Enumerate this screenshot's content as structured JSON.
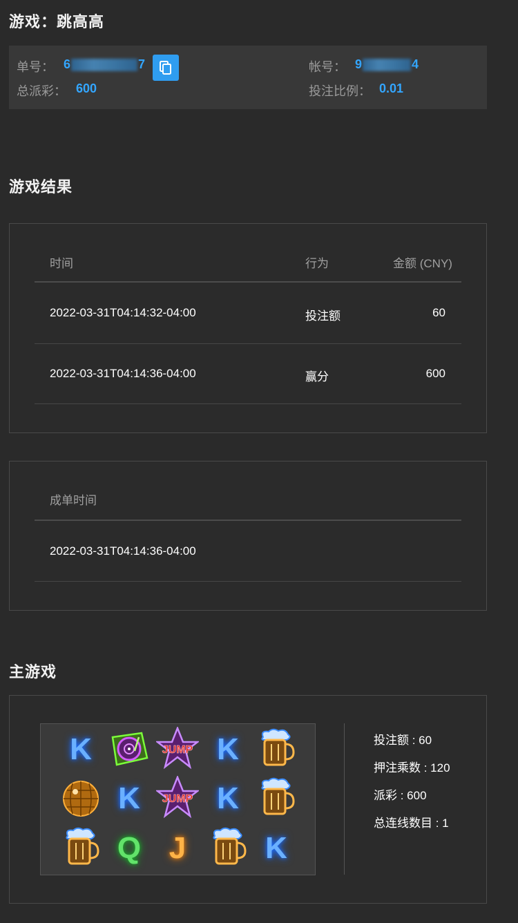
{
  "header": {
    "title_label": "游戏：",
    "title_value": "跳高高"
  },
  "info": {
    "order_label": "单号：",
    "order_prefix": "6",
    "order_suffix": "7",
    "account_label": "帐号：",
    "account_prefix": "9",
    "account_suffix": "4",
    "payout_label": "总派彩：",
    "payout_value": "600",
    "ratio_label": "投注比例：",
    "ratio_value": "0.01"
  },
  "result": {
    "section_title": "游戏结果",
    "columns": [
      "时间",
      "行为",
      "金额 (CNY)"
    ],
    "rows": [
      {
        "time": "2022-03-31T04:14:32-04:00",
        "action": "投注额",
        "amount": "60"
      },
      {
        "time": "2022-03-31T04:14:36-04:00",
        "action": "赢分",
        "amount": "600"
      }
    ]
  },
  "settle": {
    "header": "成单时间",
    "time": "2022-03-31T04:14:36-04:00"
  },
  "main_game": {
    "section_title": "主游戏",
    "reels": [
      [
        "K",
        "turntable-icon",
        "jump-star-icon",
        "K",
        "beer-mug-icon"
      ],
      [
        "disco-ball-icon",
        "K",
        "jump-star-icon",
        "K",
        "beer-mug-icon"
      ],
      [
        "beer-mug-icon",
        "Q",
        "J",
        "beer-mug-icon",
        "K"
      ]
    ],
    "jump_text": "JUMP",
    "stats": [
      "投注额 : 60",
      "押注乘数 : 120",
      "派彩 : 600",
      "总连线数目 : 1"
    ]
  }
}
